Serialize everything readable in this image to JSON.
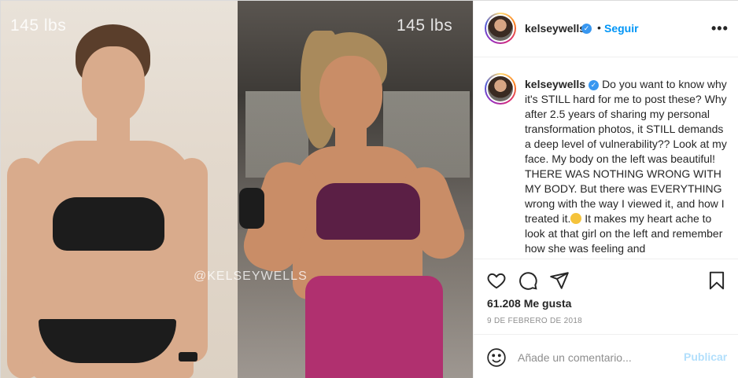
{
  "post": {
    "media": {
      "weight_left": "145 lbs",
      "weight_right": "145 lbs",
      "watermark": "@KELSEYWELLS"
    },
    "header": {
      "username": "kelseywells",
      "verified_icon": "verified-badge-icon",
      "separator": "•",
      "follow_label": "Seguir",
      "more_label": "•••"
    },
    "caption": {
      "username": "kelseywells",
      "text_part1": "Do you want to know why it's STILL hard for me to post these? Why after 2.5 years of sharing my personal transformation photos, it STILL demands a deep level of vulnerability?? Look at my face. My body on the left was beautiful! THERE WAS NOTHING WRONG WITH MY BODY. But there was EVERYTHING wrong with the way I viewed it, and how I treated it.",
      "text_part2": " It makes my heart ache to look at that girl on the left and remember how she was feeling and"
    },
    "actions": {
      "like_icon": "heart-icon",
      "comment_icon": "comment-icon",
      "share_icon": "paper-plane-icon",
      "save_icon": "bookmark-icon",
      "likes": "61.208 Me gusta",
      "date": "9 DE FEBRERO DE 2018"
    },
    "add_comment": {
      "emoji_icon": "smiley-icon",
      "placeholder": "Añade un comentario...",
      "publish_label": "Publicar"
    },
    "colors": {
      "accent": "#0095f6",
      "publish_disabled": "#b2dffc",
      "verified": "#3897f0"
    }
  }
}
